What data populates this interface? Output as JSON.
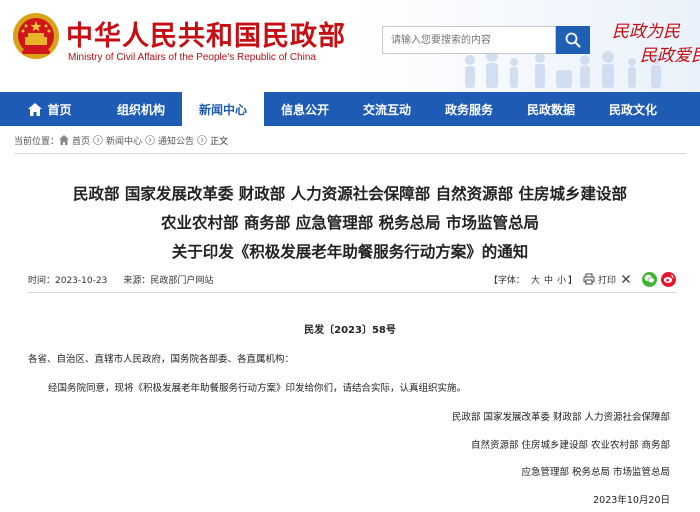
{
  "header": {
    "title_cn": "中华人民共和国民政部",
    "title_en": "Ministry of Civil Affairs of the People's Republic of China",
    "search_placeholder": "请输入您要搜索的内容",
    "slogan_line1": "民政为民",
    "slogan_line2": "民政爱民"
  },
  "nav": {
    "items": [
      {
        "label": "首页"
      },
      {
        "label": "组织机构"
      },
      {
        "label": "新闻中心"
      },
      {
        "label": "信息公开"
      },
      {
        "label": "交流互动"
      },
      {
        "label": "政务服务"
      },
      {
        "label": "民政数据"
      },
      {
        "label": "民政文化"
      }
    ],
    "active_index": 2
  },
  "breadcrumb": {
    "prefix": "当前位置：",
    "items": [
      "首页",
      "新闻中心",
      "通知公告",
      "正文"
    ]
  },
  "article": {
    "title_line1": "民政部 国家发展改革委 财政部 人力资源社会保障部 自然资源部 住房城乡建设部",
    "title_line2": "农业农村部 商务部 应急管理部 税务总局 市场监管总局",
    "title_line3": "关于印发《积极发展老年助餐服务行动方案》的通知",
    "time": "时间：2023-10-23",
    "source": "来源：民政部门户网站",
    "font_label": "【字体：",
    "font_sizes": [
      "大",
      "中",
      "小"
    ],
    "font_close": "】",
    "print_label": "打印",
    "doc_number": "民发〔2023〕58号",
    "addressee": "各省、自治区、直辖市人民政府，国务院各部委、各直属机构：",
    "body": "经国务院同意，现将《积极发展老年助餐服务行动方案》印发给你们，请结合实际，认真组织实施。",
    "sign_line1": "民政部 国家发展改革委 财政部 人力资源社会保障部",
    "sign_line2": "自然资源部 住房城乡建设部 农业农村部 商务部",
    "sign_line3": "应急管理部 税务总局 市场监管总局",
    "sign_date": "2023年10月20日"
  },
  "colors": {
    "brand_red": "#c40f14",
    "nav_blue": "#1d5bb4",
    "wechat_green": "#3fb332",
    "weibo_red": "#e6162d"
  },
  "icons": {
    "emblem": "national-emblem-icon",
    "search": "search-icon",
    "home": "home-icon",
    "print": "printer-icon",
    "close": "close-icon",
    "wechat": "wechat-icon",
    "weibo": "weibo-icon"
  }
}
